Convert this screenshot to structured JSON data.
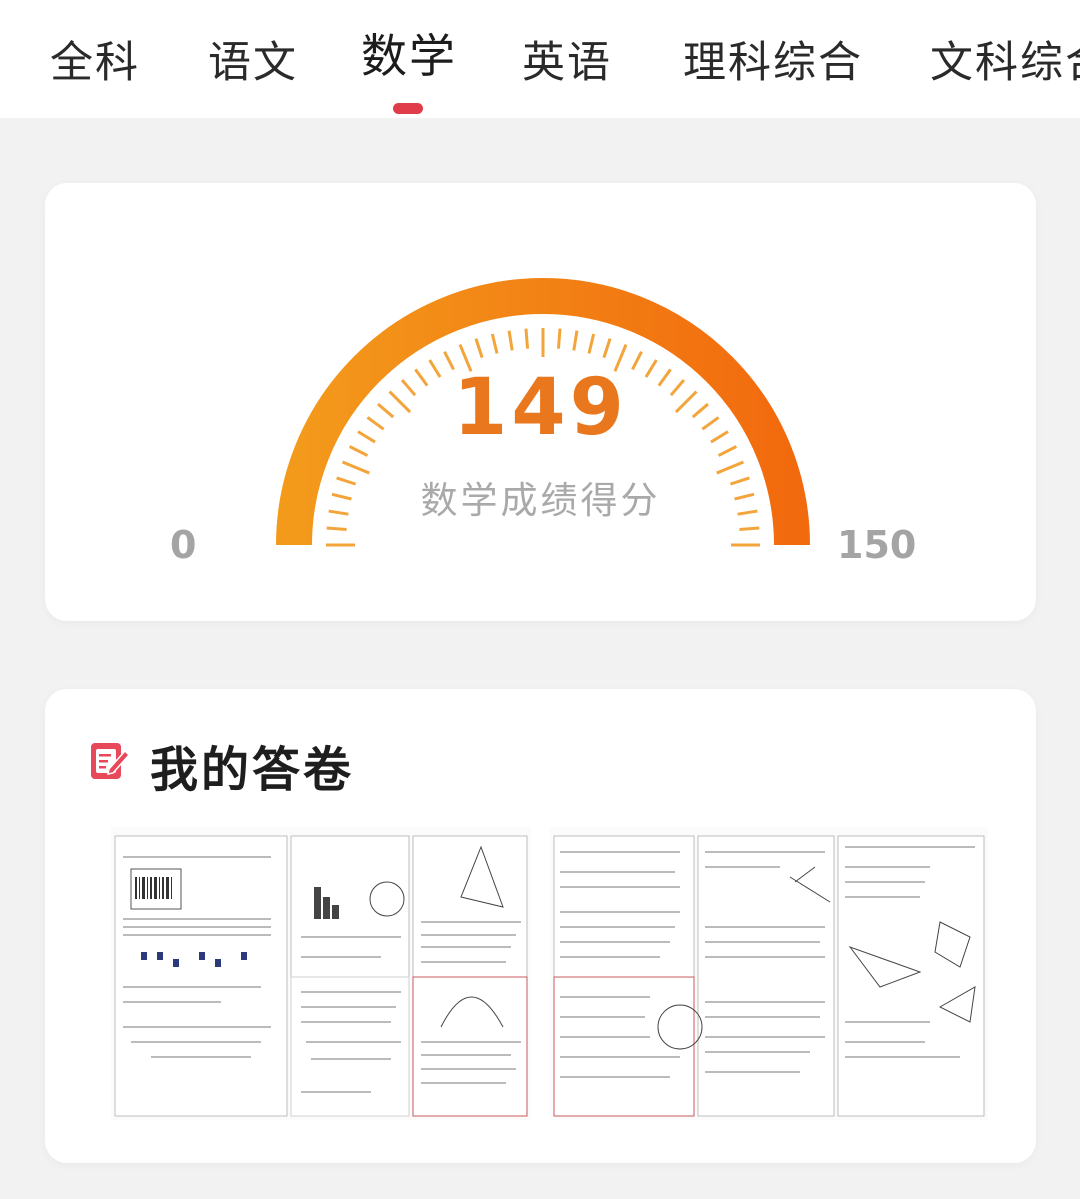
{
  "tabs": [
    {
      "label": "全科",
      "active": false
    },
    {
      "label": "语文",
      "active": false
    },
    {
      "label": "数学",
      "active": true
    },
    {
      "label": "英语",
      "active": false
    },
    {
      "label": "理科综合",
      "active": false
    },
    {
      "label": "文科综合",
      "active": false
    }
  ],
  "score_card": {
    "score": "149",
    "caption": "数学成绩得分",
    "min_label": "0",
    "max_label": "150",
    "score_value": 149,
    "score_max": 150,
    "colors": {
      "arc_start": "#f39a1b",
      "arc_end": "#f26a0e",
      "tick": "#f3a53c",
      "score": "#e8771d",
      "label": "#a4a4a4"
    }
  },
  "answer_card": {
    "title": "我的答卷",
    "icon": "exam-paper-pen-icon",
    "sheets": [
      "answer-sheet-page-1",
      "answer-sheet-page-2"
    ]
  },
  "colors": {
    "accent": "#e03c4a",
    "background": "#f2f2f2",
    "card": "#ffffff"
  }
}
